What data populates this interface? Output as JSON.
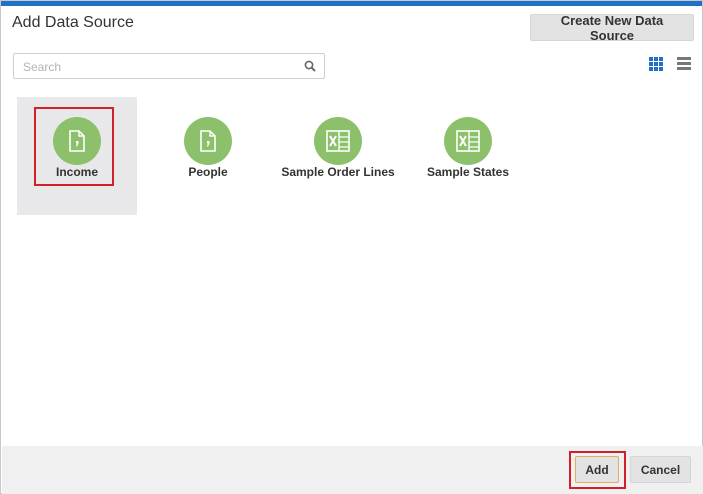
{
  "dialog": {
    "title": "Add Data Source",
    "create_button_label": "Create New Data Source"
  },
  "search": {
    "placeholder": "Search",
    "value": ""
  },
  "view_toggle": {
    "grid_icon": "grid-view-icon",
    "list_icon": "list-view-icon"
  },
  "data_sources": [
    {
      "label": "Income",
      "icon": "csv-file-icon",
      "selected": true
    },
    {
      "label": "People",
      "icon": "csv-file-icon",
      "selected": false
    },
    {
      "label": "Sample Order Lines",
      "icon": "excel-file-icon",
      "selected": false
    },
    {
      "label": "Sample States",
      "icon": "excel-file-icon",
      "selected": false
    }
  ],
  "footer": {
    "add_label": "Add",
    "cancel_label": "Cancel"
  },
  "colors": {
    "accent": "#1e73c8",
    "tile_icon_bg": "#8cc06a",
    "highlight": "#d0202a"
  }
}
